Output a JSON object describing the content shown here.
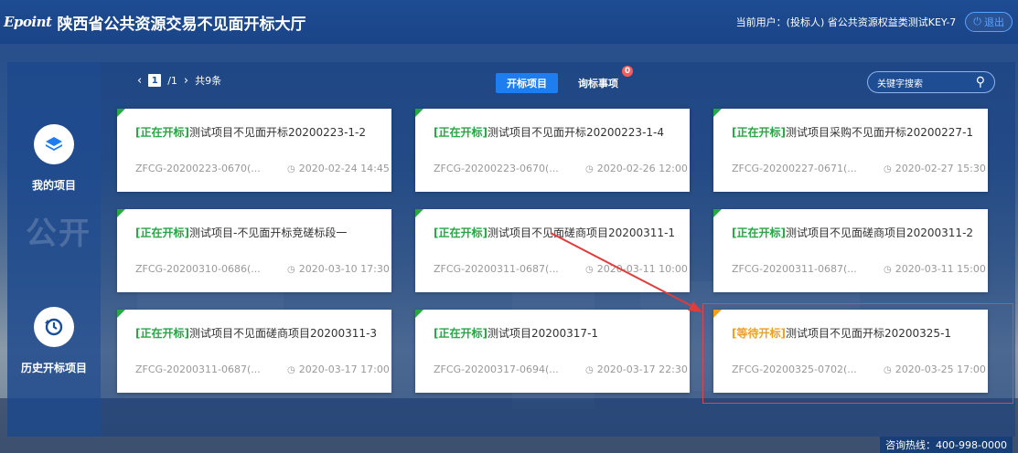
{
  "header": {
    "logo": "Epoint",
    "title": "陕西省公共资源交易不见面开标大厅",
    "user_label": "当前用户：",
    "user_name": "(投标人) 省公共资源权益类测试KEY-7",
    "logout_label": "退出"
  },
  "sidebar": {
    "items": [
      {
        "label": "我的项目",
        "icon": "layers-icon"
      },
      {
        "label": "历史开标项目",
        "icon": "history-icon"
      }
    ],
    "watermark": "公开"
  },
  "pager": {
    "current": "1",
    "total": "/1",
    "count": "共9条"
  },
  "tabs": [
    {
      "label": "开标项目",
      "active": true
    },
    {
      "label": "询标事项",
      "active": false,
      "badge": "0"
    }
  ],
  "search": {
    "placeholder": "关键字搜索"
  },
  "colors": {
    "open": "#28a745",
    "waiting": "#f0a020",
    "accent": "#1e7ef0"
  },
  "cards": [
    {
      "tag": "[正在开标]",
      "status": "open",
      "name": "测试项目不见面开标20200223-1-2",
      "code": "ZFCG-20200223-0670(...",
      "time": "2020-02-24 14:45"
    },
    {
      "tag": "[正在开标]",
      "status": "open",
      "name": "测试项目不见面开标20200223-1-4",
      "code": "ZFCG-20200223-0670(...",
      "time": "2020-02-26 12:00"
    },
    {
      "tag": "[正在开标]",
      "status": "open",
      "name": "测试项目采购不见面开标20200227-1",
      "code": "ZFCG-20200227-0671(...",
      "time": "2020-02-27 15:30"
    },
    {
      "tag": "[正在开标]",
      "status": "open",
      "name": "测试项目-不见面开标竞磋标段一",
      "code": "ZFCG-20200310-0686(...",
      "time": "2020-03-10 17:30"
    },
    {
      "tag": "[正在开标]",
      "status": "open",
      "name": "测试项目不见面磋商项目20200311-1",
      "code": "ZFCG-20200311-0687(...",
      "time": "2020-03-11 10:00"
    },
    {
      "tag": "[正在开标]",
      "status": "open",
      "name": "测试项目不见面磋商项目20200311-2",
      "code": "ZFCG-20200311-0687(...",
      "time": "2020-03-11 15:00"
    },
    {
      "tag": "[正在开标]",
      "status": "open",
      "name": "测试项目不见面磋商项目20200311-3",
      "code": "ZFCG-20200311-0687(...",
      "time": "2020-03-17 17:00"
    },
    {
      "tag": "[正在开标]",
      "status": "open",
      "name": "测试项目20200317-1",
      "code": "ZFCG-20200317-0694(...",
      "time": "2020-03-17 22:30"
    },
    {
      "tag": "[等待开标]",
      "status": "waiting",
      "name": "测试项目不见面开标20200325-1",
      "code": "ZFCG-20200325-0702(...",
      "time": "2020-03-25 17:00"
    }
  ],
  "footer": {
    "hotline": "咨询热线：400-998-0000"
  }
}
